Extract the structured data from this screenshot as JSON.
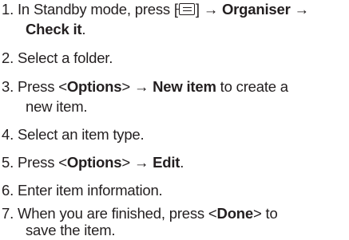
{
  "steps": [
    {
      "num": "1.",
      "text1": "In Standby mode, press [",
      "icon": "menu-key-icon",
      "text2": "] → ",
      "bold1": "Organiser",
      "text3": " →",
      "line2_bold": "Check it",
      "line2_text": "."
    },
    {
      "num": "2.",
      "text": "Select a folder."
    },
    {
      "num": "3.",
      "text1": "Press <",
      "bold1": "Options",
      "text2": "> → ",
      "bold2": "New item",
      "text3": " to create a",
      "line2_text": "new item."
    },
    {
      "num": "4.",
      "text": "Select an item type."
    },
    {
      "num": "5.",
      "text1": "Press <",
      "bold1": "Options",
      "text2": "> → ",
      "bold2": "Edit",
      "text3": "."
    },
    {
      "num": "6.",
      "text": "Enter item information."
    },
    {
      "num": "7.",
      "text1": "When you are finished, press <",
      "bold1": "Done",
      "text2": "> to",
      "line2_text": "save the item."
    }
  ]
}
